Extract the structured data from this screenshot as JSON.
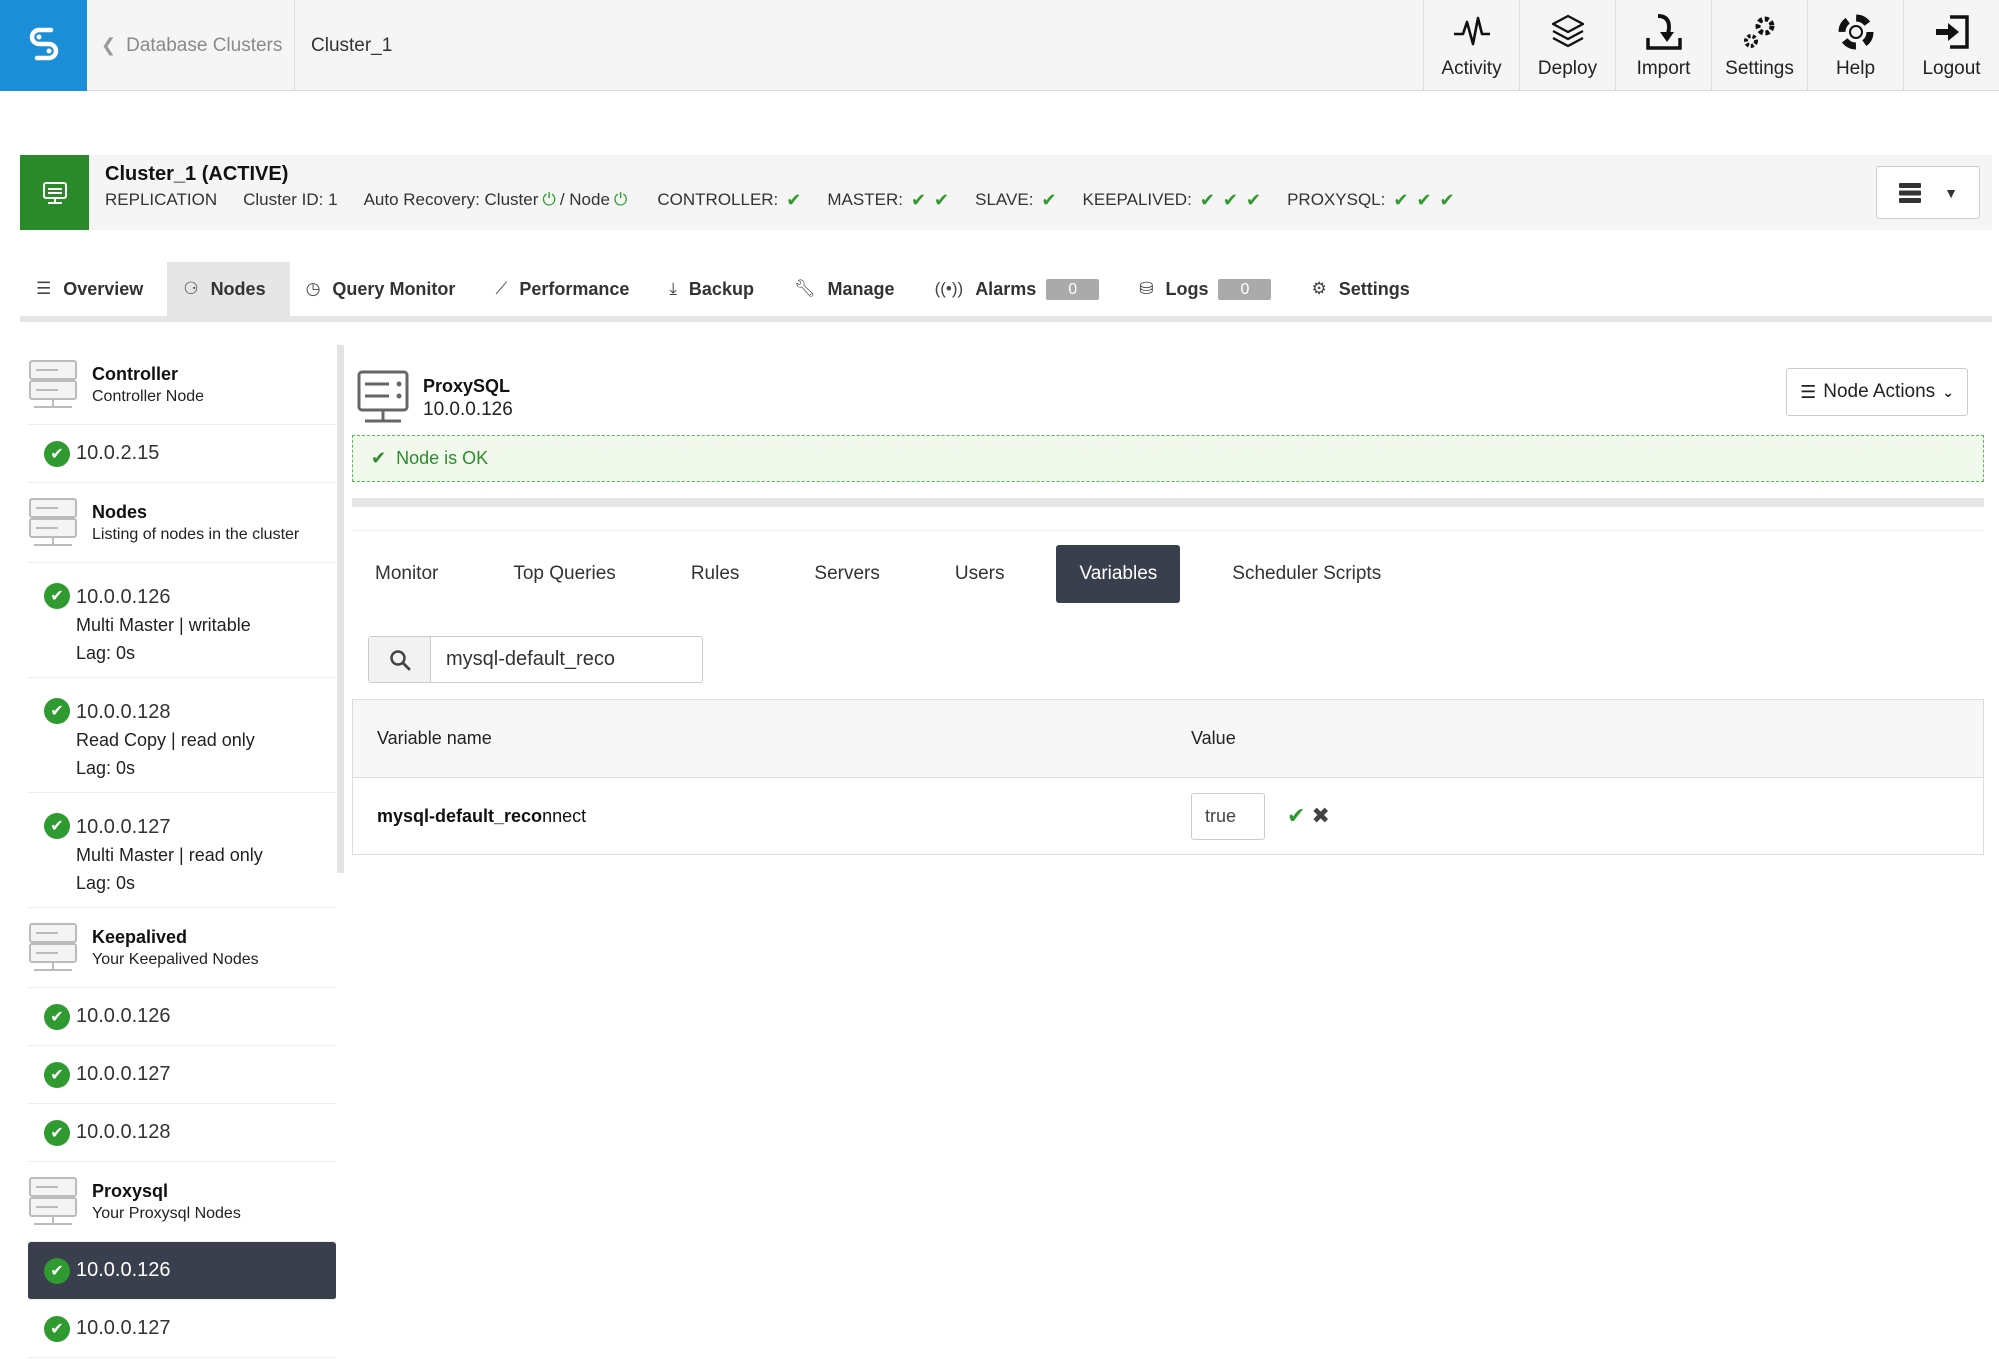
{
  "topbar": {
    "back_label": "Database Clusters",
    "current": "Cluster_1",
    "nav": [
      {
        "label": "Activity",
        "icon": "activity-icon"
      },
      {
        "label": "Deploy",
        "icon": "deploy-icon"
      },
      {
        "label": "Import",
        "icon": "import-icon"
      },
      {
        "label": "Settings",
        "icon": "settings-icon"
      },
      {
        "label": "Help",
        "icon": "help-icon"
      },
      {
        "label": "Logout",
        "icon": "logout-icon"
      }
    ]
  },
  "cluster": {
    "title": "Cluster_1 (ACTIVE)",
    "type": "REPLICATION",
    "id_label": "Cluster ID: 1",
    "auto_recovery": "Auto Recovery: Cluster",
    "auto_recovery_node": "/ Node",
    "controller": "CONTROLLER:",
    "master": "MASTER:",
    "slave": "SLAVE:",
    "keepalived": "KEEPALIVED:",
    "proxysql": "PROXYSQL:"
  },
  "tabs": [
    {
      "label": "Overview"
    },
    {
      "label": "Nodes"
    },
    {
      "label": "Query Monitor"
    },
    {
      "label": "Performance"
    },
    {
      "label": "Backup"
    },
    {
      "label": "Manage"
    },
    {
      "label": "Alarms",
      "badge": "0"
    },
    {
      "label": "Logs",
      "badge": "0"
    },
    {
      "label": "Settings"
    }
  ],
  "sidebar": {
    "controller": {
      "title": "Controller",
      "subtitle": "Controller Node",
      "ip": "10.0.2.15"
    },
    "nodes": {
      "title": "Nodes",
      "subtitle": "Listing of nodes in the cluster",
      "items": [
        {
          "ip": "10.0.0.126",
          "role": "Multi Master | writable",
          "lag": "Lag: 0s"
        },
        {
          "ip": "10.0.0.128",
          "role": "Read Copy | read only",
          "lag": "Lag: 0s"
        },
        {
          "ip": "10.0.0.127",
          "role": "Multi Master | read only",
          "lag": "Lag: 0s"
        }
      ]
    },
    "keepalived": {
      "title": "Keepalived",
      "subtitle": "Your Keepalived Nodes",
      "items": [
        "10.0.0.126",
        "10.0.0.127",
        "10.0.0.128"
      ]
    },
    "proxysql": {
      "title": "Proxysql",
      "subtitle": "Your Proxysql Nodes",
      "items": [
        "10.0.0.126",
        "10.0.0.127"
      ]
    }
  },
  "node": {
    "title": "ProxySQL",
    "ip": "10.0.0.126",
    "actions_label": "Node Actions",
    "status": "Node is OK"
  },
  "subtabs": [
    "Monitor",
    "Top Queries",
    "Rules",
    "Servers",
    "Users",
    "Variables",
    "Scheduler Scripts"
  ],
  "search": {
    "value": "mysql-default_reco"
  },
  "variables": {
    "col_name": "Variable name",
    "col_value": "Value",
    "rows": [
      {
        "name_match": "mysql-default_reco",
        "name_rest": "nnect",
        "value": "true"
      }
    ]
  },
  "colors": {
    "brand": "#1a8fd8",
    "ok": "#2f9a2f",
    "active_tab": "#3a3f4e"
  }
}
